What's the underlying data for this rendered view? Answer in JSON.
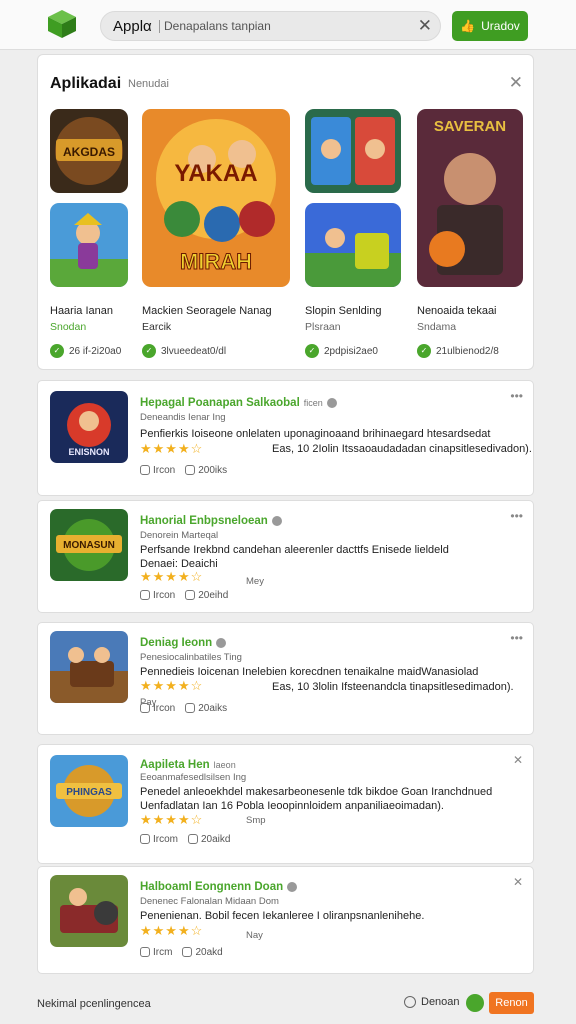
{
  "header": {
    "search_query": "Applα",
    "search_placeholder": "Denapalans tanpian",
    "update_label": "Uradov",
    "colors": {
      "accent": "#3f9d22",
      "orange": "#f07421"
    }
  },
  "featured": {
    "title": "Aplikadai",
    "subtitle": "Nenudai",
    "items": [
      {
        "name": "Haaria Ianan",
        "sub": "Snodan",
        "count": "26 if-2i20a0"
      },
      {
        "name": "Mackien Seoragele Nanag",
        "sub": "Earcik",
        "count": "3lvueedeat0/dl"
      },
      {
        "name": "Slopin Senlding",
        "sub": "Plsraan",
        "count": "2pdpisi2ae0"
      },
      {
        "name": "Nenoaida tekaai",
        "sub": "Sndama",
        "count": "21ulbienod2/8"
      }
    ],
    "thumb_labels": [
      "AKGDAS",
      "YAKAA",
      "MIRAH",
      "SAVERAN"
    ]
  },
  "apps": [
    {
      "name": "Hepagal Poanapan Salkaobal",
      "tag": "ficen",
      "dev": "Deneandis Ienar Ing",
      "desc1": "Penfierkis Ioiseone onlelaten uponaginoaand brihinaegard htesardsedat",
      "desc2": "Eas, 10 2Iolin Itssaoaudadadan cinapsitlesedivadon).",
      "rating": "★★★★☆",
      "r_sub": "Eas,",
      "size": "Ircon",
      "downloads": "200iks",
      "icon_label": "ENISNON"
    },
    {
      "name": "Hanorial Enbpsneloean",
      "tag": "",
      "dev": "Denorein Marteqal",
      "desc1": "Perfsande Irekbnd candehan aleerenler dacttfs Enisede lieldeld",
      "desc2": "Denaei: Deaichi",
      "rating": "★★★★☆",
      "r_sub": "Mey",
      "size": "Ircon",
      "downloads": "20eihd",
      "icon_label": "MONASUN"
    },
    {
      "name": "Deniag Ieonn",
      "tag": "",
      "dev": "Penesiocalinbatiles Ting",
      "desc1": "Pennedieis Ioicenan Inelebien korecdnen tenaikalne maidWanasiolad",
      "desc2": "Eas, 10 3lolin Ifsteenandcla tinapsitlesedimadon).",
      "rating": "★★★★☆",
      "r_sub": "Pay",
      "size": "Ircon",
      "downloads": "20aiks",
      "icon_label": ""
    },
    {
      "name": "Aapileta Hen",
      "tag": "laeon",
      "dev": "Eeoanmafesedlsilsen Ing",
      "desc1": "Penedel anleoekhdel makesarbeonesenle tdk bikdoe Goan Iranchdnued",
      "desc2": "Uenfadlatan Ian 16 Pobla Ieoopinnloidem anpaniliaeoimadan).",
      "rating": "★★★★☆",
      "r_sub": "Smp",
      "size": "Ircom",
      "downloads": "20aikd",
      "icon_label": "PHINGAS"
    },
    {
      "name": "Halboaml Eongnenn Doan",
      "tag": "",
      "dev": "Denenec Falonalan Midaan Dom",
      "desc1": "Penenienan. Bobil fecen Iekanleree I oliranpsnanlenihehe.",
      "desc2": "",
      "rating": "★★★★☆",
      "r_sub": "Nay",
      "size": "Ircm",
      "downloads": "20akd",
      "icon_label": ""
    }
  ],
  "footer": {
    "left_text": "Nekimal pcenlingencea",
    "done_label": "Denoan",
    "button_label": "Renon"
  }
}
